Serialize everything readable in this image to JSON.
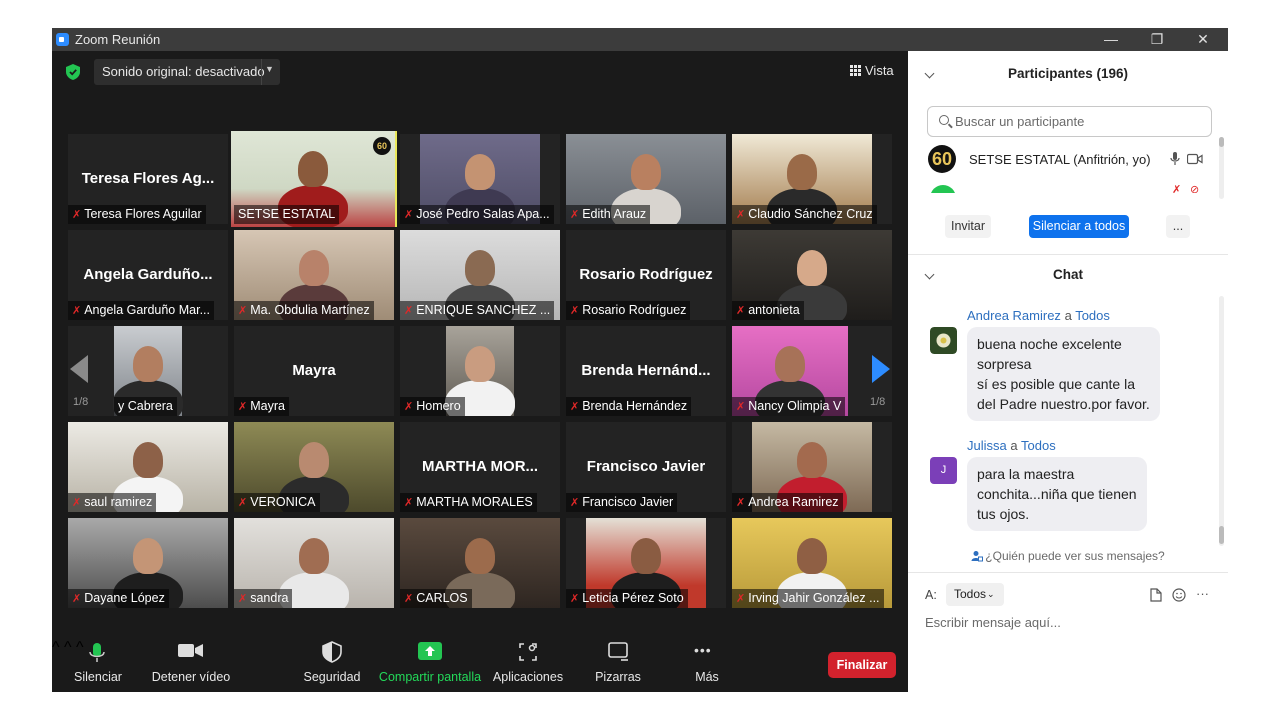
{
  "window": {
    "title": "Zoom Reunión",
    "minimize_glyph": "—",
    "restore_glyph": "❐",
    "close_glyph": "✕"
  },
  "meeting": {
    "sound_label": "Sonido original: desactivado",
    "view_label": "Vista",
    "page_left": "1/8",
    "page_right": "1/8",
    "tiles": [
      {
        "big": "Teresa Flores Ag...",
        "name": "Teresa Flores Aguilar"
      },
      {
        "big": "",
        "name": "SETSE ESTATAL",
        "badge": "60"
      },
      {
        "big": "",
        "name": "José Pedro Salas Apa..."
      },
      {
        "big": "",
        "name": "Edith Arauz"
      },
      {
        "big": "",
        "name": "Claudio Sánchez Cruz"
      },
      {
        "big": "Angela  Garduño...",
        "name": "Angela Garduño Mar..."
      },
      {
        "big": "",
        "name": "Ma. Obdulia Martínez"
      },
      {
        "big": "",
        "name": "ENRIQUE SANCHEZ ..."
      },
      {
        "big": "Rosario Rodríguez",
        "name": "Rosario Rodríguez"
      },
      {
        "big": "",
        "name": "antonieta"
      },
      {
        "big": "",
        "name": "y Cabrera"
      },
      {
        "big": "Mayra",
        "name": "Mayra"
      },
      {
        "big": "",
        "name": "Homero"
      },
      {
        "big": "Brenda  Hernánd...",
        "name": "Brenda Hernández"
      },
      {
        "big": "",
        "name": "Nancy Olimpia V"
      },
      {
        "big": "",
        "name": "saul ramirez"
      },
      {
        "big": "",
        "name": "VERONICA"
      },
      {
        "big": "MARTHA   MOR...",
        "name": "MARTHA  MORALES"
      },
      {
        "big": "Francisco Javier",
        "name": "Francisco Javier"
      },
      {
        "big": "",
        "name": "Andrea Ramirez"
      },
      {
        "big": "",
        "name": "Dayane López"
      },
      {
        "big": "",
        "name": "sandra"
      },
      {
        "big": "",
        "name": "CARLOS"
      },
      {
        "big": "",
        "name": "Leticia Pérez Soto"
      },
      {
        "big": "",
        "name": "Irving Jahir González ..."
      }
    ]
  },
  "toolbar": {
    "mute_label": "Silenciar",
    "video_label": "Detener vídeo",
    "security_label": "Seguridad",
    "share_label": "Compartir pantalla",
    "apps_label": "Aplicaciones",
    "whiteboard_label": "Pizarras",
    "more_label": "Más",
    "more_glyph": "•••",
    "end_label": "Finalizar",
    "share_color": "#23d959",
    "end_color": "#d2222d"
  },
  "participants": {
    "header": "Participantes (196)",
    "search_placeholder": "Buscar un participante",
    "self_name": "SETSE ESTATAL (Anfitrión, yo)",
    "self_badge": "60",
    "invite_label": "Invitar",
    "mute_all_label": "Silenciar a todos",
    "more_label": "..."
  },
  "chat": {
    "header": "Chat",
    "to_word": "a",
    "messages": [
      {
        "sender": "Andrea Ramirez",
        "to": "Todos",
        "lines": [
          "buena noche excelente",
          "sorpresa",
          "sí es posible que cante la",
          "del Padre nuestro.por favor."
        ]
      },
      {
        "sender": "Julissa",
        "to": "Todos",
        "avatar_letter": "J",
        "lines": [
          "para la maestra",
          "conchita...niña que tienen",
          "tus ojos."
        ]
      }
    ],
    "who_can_see": "¿Quién puede ver sus mensajes?",
    "to_label": "A:",
    "to_value": "Todos",
    "compose_placeholder": "Escribir mensaje aquí...",
    "more_glyph": "···"
  },
  "colors": {
    "accent": "#2d8cff",
    "active_speaker": "#e9e75a",
    "mute_red": "#e02828"
  }
}
